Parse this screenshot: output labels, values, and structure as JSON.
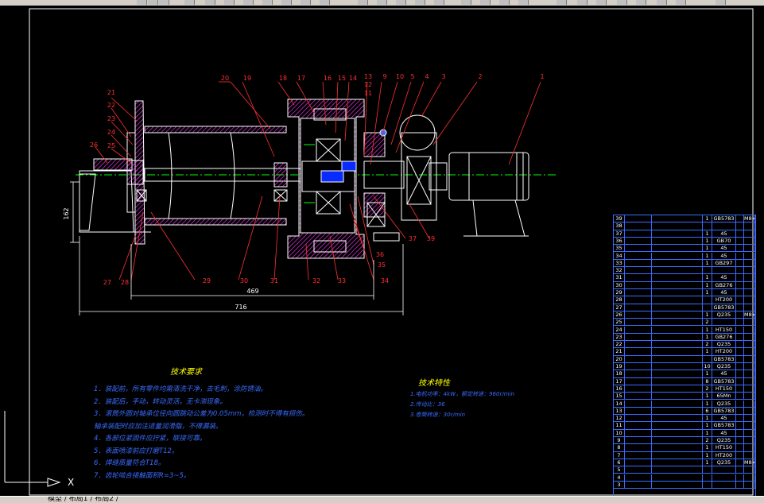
{
  "colors": {
    "background": "#000000",
    "outline": "#ffffff",
    "hatch": "#ff3fff",
    "leader": "#ff3030",
    "center": "#00ff00",
    "text_blue": "#3a6bff",
    "text_yellow": "#ffff00",
    "section_fill": "#ff3fff"
  },
  "part_numbers_top": [
    "20",
    "19",
    "18",
    "17",
    "16",
    "15",
    "14",
    "13",
    "12",
    "11",
    "9",
    "10",
    "5",
    "4",
    "3",
    "2",
    "1"
  ],
  "part_numbers_left": [
    "21",
    "22",
    "23",
    "24",
    "25",
    "26"
  ],
  "part_numbers_bottom": [
    "27",
    "28",
    "29",
    "30",
    "31",
    "32",
    "33",
    "34",
    "35",
    "36",
    "37",
    "39"
  ],
  "dimensions": {
    "d162": "162",
    "d469": "469",
    "d716": "716"
  },
  "tech": {
    "title": "技术要求",
    "lines": [
      "1．装配前，所有零件均需清洗干净，去毛刺，涂防锈油。",
      "2．装配后，手动，转动灵活，无卡滞现象。",
      "3．滚筒外圆对轴承位径向圆跳动公差为0.05mm，检测时不得有损伤。",
      "   轴承装配时应加注适量润滑脂，不得漏装。",
      "4．各部位紧固件应拧紧，联接可靠。",
      "5．表面喷漆前应打磨T12。",
      "6．焊缝质量符合T18。",
      "7．齿轮啮合接触面积R=3~5。"
    ]
  },
  "spec": {
    "title": "技术特性",
    "lines": [
      "1.电机功率：4kW，额定转速：960r/min",
      "2.传动比：36",
      "3.卷筒转速：30r/min"
    ]
  },
  "bom": {
    "rows": [
      [
        "39",
        "",
        "",
        "1",
        "GB5783",
        "",
        "M8×30"
      ],
      [
        "38",
        "",
        "",
        "",
        "",
        "",
        ""
      ],
      [
        "37",
        "",
        "",
        "1",
        "45",
        "",
        ""
      ],
      [
        "36",
        "",
        "",
        "1",
        "GB70",
        "",
        ""
      ],
      [
        "35",
        "",
        "",
        "1",
        "45",
        "",
        ""
      ],
      [
        "34",
        "",
        "",
        "1",
        "45",
        "",
        ""
      ],
      [
        "33",
        "",
        "",
        "1",
        "GB297",
        "",
        ""
      ],
      [
        "32",
        "",
        "",
        "",
        "",
        "",
        ""
      ],
      [
        "31",
        "",
        "",
        "1",
        "45",
        "",
        ""
      ],
      [
        "30",
        "",
        "",
        "1",
        "GB276",
        "",
        ""
      ],
      [
        "29",
        "",
        "",
        "1",
        "45",
        "",
        ""
      ],
      [
        "28",
        "",
        "",
        "",
        "HT200",
        "",
        ""
      ],
      [
        "27",
        "",
        "",
        "",
        "GB5783",
        "",
        ""
      ],
      [
        "26",
        "",
        "",
        "1",
        "Q235",
        "",
        "M8×30"
      ],
      [
        "25",
        "",
        "",
        "2",
        "",
        "",
        ""
      ],
      [
        "24",
        "",
        "",
        "1",
        "HT150",
        "",
        ""
      ],
      [
        "23",
        "",
        "",
        "1",
        "GB276",
        "",
        ""
      ],
      [
        "22",
        "",
        "",
        "2",
        "Q235",
        "",
        ""
      ],
      [
        "21",
        "",
        "",
        "1",
        "HT200",
        "",
        ""
      ],
      [
        "20",
        "",
        "",
        "",
        "GB5783",
        "",
        ""
      ],
      [
        "19",
        "",
        "",
        "10",
        "Q235",
        "",
        ""
      ],
      [
        "18",
        "",
        "",
        "1",
        "45",
        "",
        ""
      ],
      [
        "17",
        "",
        "",
        "8",
        "GB5783",
        "",
        ""
      ],
      [
        "16",
        "",
        "",
        "2",
        "HT150",
        "",
        ""
      ],
      [
        "15",
        "",
        "",
        "1",
        "65Mn",
        "",
        ""
      ],
      [
        "14",
        "",
        "",
        "1",
        "Q235",
        "",
        ""
      ],
      [
        "13",
        "",
        "",
        "6",
        "GB5783",
        "",
        ""
      ],
      [
        "12",
        "",
        "",
        "1",
        "45",
        "",
        ""
      ],
      [
        "11",
        "",
        "",
        "1",
        "GB5783",
        "",
        ""
      ],
      [
        "10",
        "",
        "",
        "1",
        "45",
        "",
        ""
      ],
      [
        "9",
        "",
        "",
        "2",
        "Q235",
        "",
        ""
      ],
      [
        "8",
        "",
        "",
        "1",
        "HT150",
        "",
        ""
      ],
      [
        "7",
        "",
        "",
        "1",
        "HT200",
        "",
        ""
      ],
      [
        "6",
        "",
        "",
        "1",
        "Q235",
        "",
        "M8×12"
      ],
      [
        "5",
        "",
        "",
        "",
        "",
        "",
        ""
      ],
      [
        "4",
        "",
        "",
        "",
        "",
        "",
        ""
      ],
      [
        "3",
        "",
        "",
        "",
        "",
        "",
        ""
      ]
    ]
  },
  "axis_label": "X",
  "status": {
    "tabs": "模型 / 布局1 / 布局2 /"
  }
}
